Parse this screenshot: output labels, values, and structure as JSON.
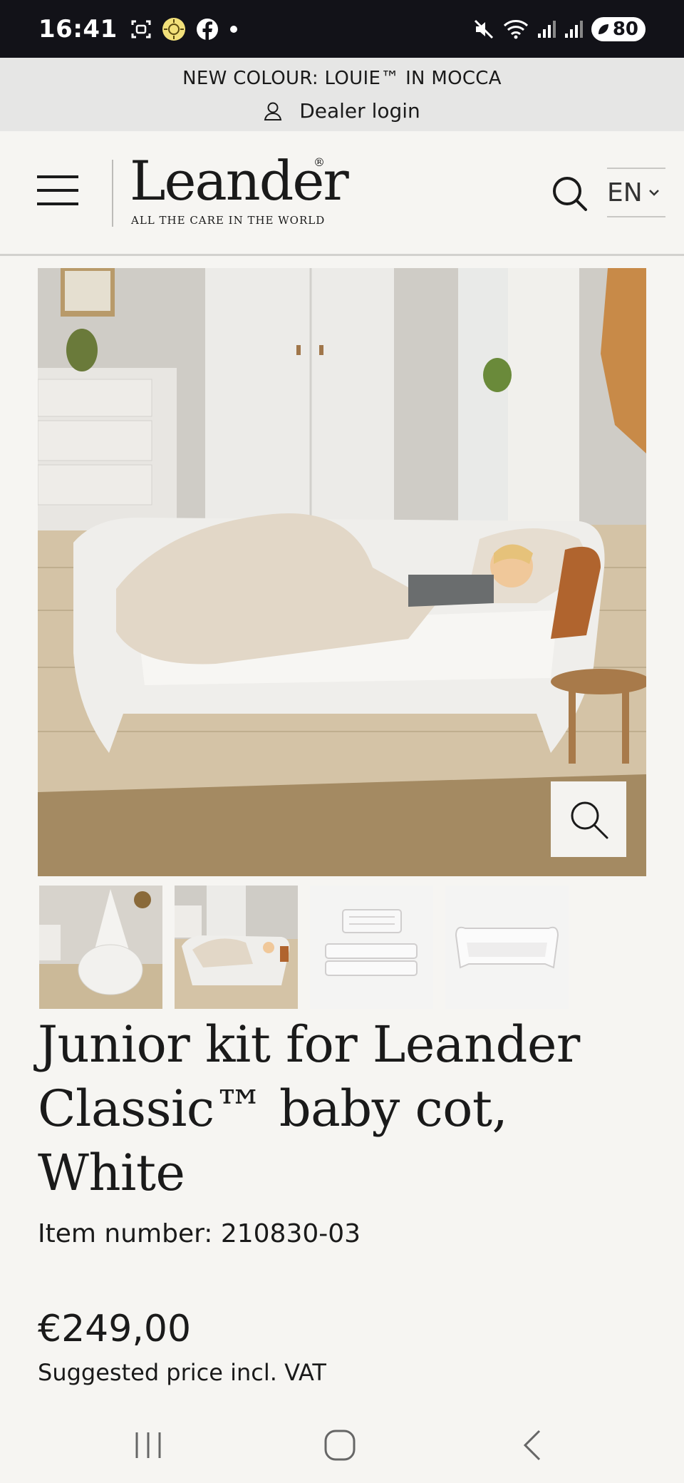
{
  "status_bar": {
    "time": "16:41",
    "battery": "80",
    "icons": [
      "screenshot-icon",
      "sun-app-icon",
      "facebook-icon",
      "dot-icon",
      "mute-icon",
      "wifi-icon",
      "signal-icon",
      "signal-icon",
      "battery-icon"
    ]
  },
  "announcement": {
    "text": "NEW COLOUR: LOUIE™ IN MOCCA",
    "dealer_login": "Dealer login"
  },
  "header": {
    "logo_word": "Leander",
    "logo_registered": "®",
    "logo_tagline": "ALL THE CARE IN THE WORLD",
    "language": "EN"
  },
  "product": {
    "title": "Junior kit for Leander Classic™ baby cot, White",
    "item_number": "Item number: 210830-03",
    "price": "€249,00",
    "price_note": "Suggested price incl. VAT",
    "thumbnails": [
      "cot-with-canopy",
      "junior-bed-room",
      "junior-kit-parts",
      "junior-bed-white"
    ]
  },
  "colors": {
    "status_bar_bg": "#121218",
    "announcement_bg": "#e6e6e5",
    "page_bg": "#f6f5f2",
    "text": "#1a1a1a"
  }
}
